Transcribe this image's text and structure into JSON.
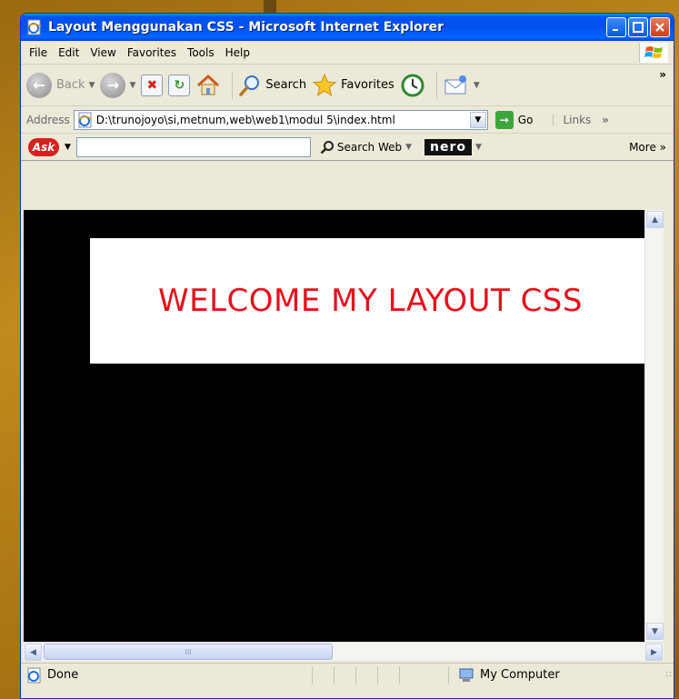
{
  "window": {
    "title": "Layout Menggunakan CSS - Microsoft Internet Explorer",
    "minimize_icon": "minimize-icon",
    "maximize_icon": "maximize-icon",
    "close_icon": "close-icon"
  },
  "menu": {
    "items": [
      "File",
      "Edit",
      "View",
      "Favorites",
      "Tools",
      "Help"
    ]
  },
  "toolbar": {
    "back_label": "Back",
    "search_label": "Search",
    "favorites_label": "Favorites",
    "overflow": "»"
  },
  "address": {
    "label": "Address",
    "value": "D:\\trunojoyo\\si,metnum,web\\web1\\modul 5\\index.html",
    "go_label": "Go",
    "links_label": "Links",
    "links_overflow": "»"
  },
  "ask_toolbar": {
    "logo": "Ask",
    "search_value": "",
    "search_web_label": "Search Web",
    "nero_logo": "nero",
    "more_label": "More"
  },
  "content": {
    "background_color": "#000000",
    "banner_text": "WELCOME MY LAYOUT CSS",
    "banner_text_color": "#e8101c"
  },
  "scrollbar": {
    "grip": "III"
  },
  "status": {
    "text": "Done",
    "zone": "My Computer"
  }
}
